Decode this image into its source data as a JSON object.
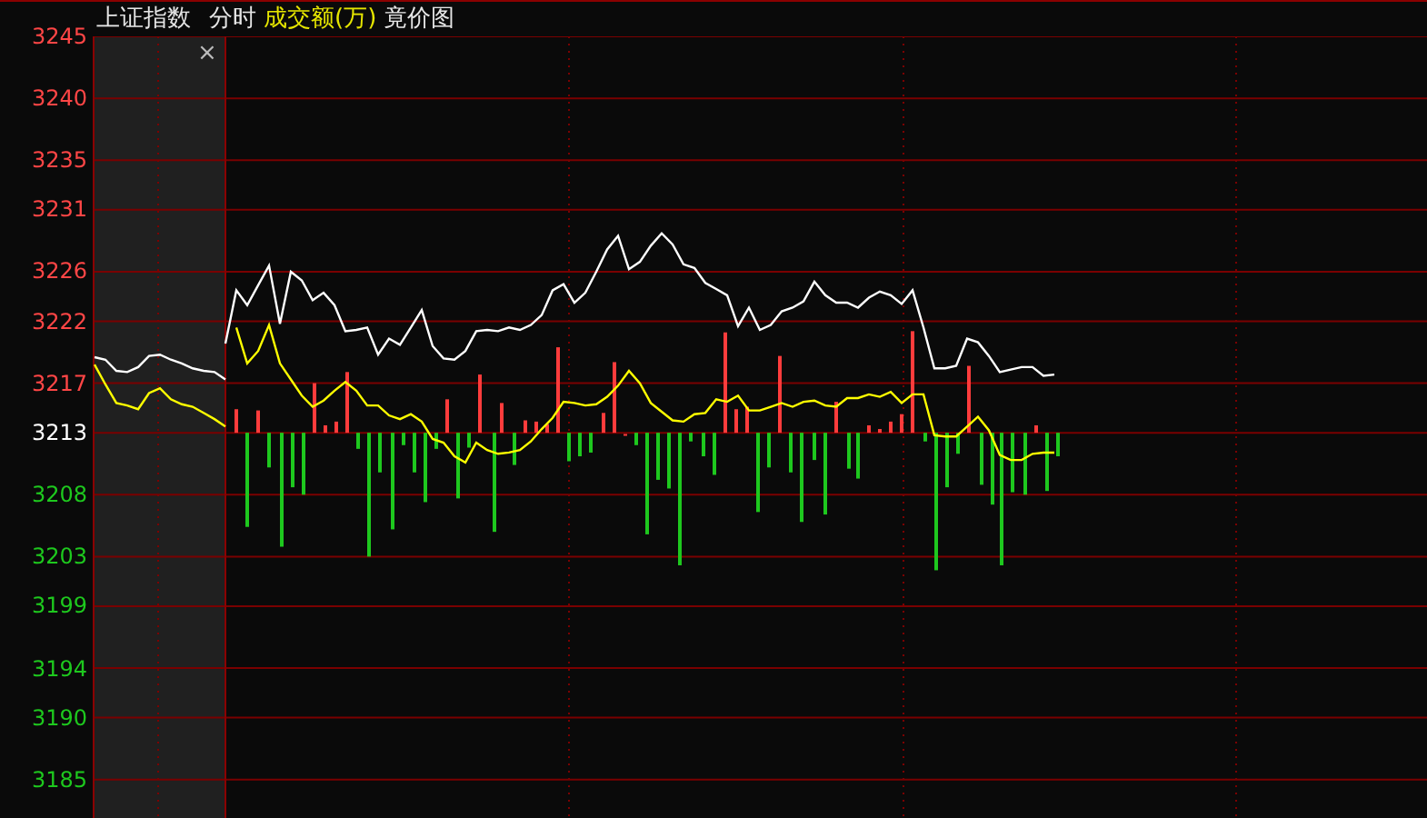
{
  "header": {
    "symbol": "上证指数",
    "mode": "分时",
    "indicator": "成交额(万)",
    "view": "竟价图"
  },
  "auction_panel": {
    "close": "×"
  },
  "chart": {
    "chart_data": {
      "type": "line",
      "ylim": [
        3181.9,
        3245
      ],
      "grid": true,
      "yticks": [
        {
          "value": 3245,
          "label": "3245"
        },
        {
          "value": 3240,
          "label": "3240"
        },
        {
          "value": 3235,
          "label": "3235"
        },
        {
          "value": 3231,
          "label": "3231"
        },
        {
          "value": 3226,
          "label": "3226"
        },
        {
          "value": 3222,
          "label": "3222"
        },
        {
          "value": 3217,
          "label": "3217"
        },
        {
          "value": 3213,
          "label": "3213"
        },
        {
          "value": 3208,
          "label": "3208"
        },
        {
          "value": 3203,
          "label": "3203"
        },
        {
          "value": 3199,
          "label": "3199"
        },
        {
          "value": 3194,
          "label": "3194"
        },
        {
          "value": 3190,
          "label": "3190"
        },
        {
          "value": 3185,
          "label": "3185"
        }
      ],
      "categories": [
        null,
        null,
        null,
        null,
        null,
        null,
        null,
        null,
        null,
        null,
        null,
        null,
        null,
        null,
        null,
        null,
        null,
        null,
        null,
        null,
        null,
        null,
        null,
        null,
        null,
        null,
        null,
        null,
        null,
        null,
        null,
        null,
        null,
        null,
        null,
        null,
        null,
        null,
        null,
        null,
        null,
        null,
        null,
        null,
        null,
        null,
        null,
        null,
        null,
        null,
        null,
        null,
        null,
        null,
        null,
        null,
        null,
        null,
        null,
        null,
        null,
        null,
        null,
        null,
        null,
        null,
        null,
        null,
        null,
        null,
        null,
        null,
        null,
        null,
        null,
        null,
        null,
        null,
        null,
        null,
        null,
        null,
        null,
        null,
        null,
        null,
        null,
        null,
        null
      ],
      "series": [
        {
          "color": "#ffffff",
          "values": [
            3219.1,
            3218.9,
            3218.0,
            3217.9,
            3218.3,
            3219.2,
            3219.3,
            3218.9,
            3218.6,
            3218.2,
            3218.0,
            3217.9,
            3217.3,
            null,
            null,
            null,
            null,
            null,
            null,
            null,
            null,
            null,
            null,
            null,
            null,
            null,
            null,
            null,
            null,
            null,
            null,
            null,
            null,
            null,
            null,
            null,
            null,
            null,
            null,
            null,
            null,
            null,
            null,
            null,
            null,
            null,
            null,
            null,
            null,
            null,
            null,
            null,
            null,
            null,
            null,
            null,
            null,
            null,
            null,
            null,
            null,
            null,
            null,
            null,
            null,
            null,
            null,
            null,
            null,
            null,
            null,
            null,
            null,
            null,
            null,
            null,
            null,
            null,
            null,
            null,
            null,
            null,
            null,
            null,
            null,
            null,
            null,
            null,
            null
          ]
        },
        {
          "color": "#ffff00",
          "values": [
            3218.5,
            3216.9,
            3215.4,
            3215.2,
            3214.9,
            3216.2,
            3216.6,
            3215.7,
            3215.3,
            3215.1,
            3214.6,
            3214.1,
            3213.5,
            null,
            null,
            null,
            null,
            null,
            null,
            null,
            null,
            null,
            null,
            null,
            null,
            null,
            null,
            null,
            null,
            null,
            null,
            null,
            null,
            null,
            null,
            null,
            null,
            null,
            null,
            null,
            null,
            null,
            null,
            null,
            null,
            null,
            null,
            null,
            null,
            null,
            null,
            null,
            null,
            null,
            null,
            null,
            null,
            null,
            null,
            null,
            null,
            null,
            null,
            null,
            null,
            null,
            null,
            null,
            null,
            null,
            null,
            null,
            null,
            null,
            null,
            null,
            null,
            null,
            null,
            null,
            null,
            null,
            null,
            null,
            null,
            null,
            null,
            null,
            null
          ]
        },
        {
          "color": "#ffffff",
          "values": [
            null,
            null,
            null,
            null,
            null,
            null,
            null,
            null,
            null,
            null,
            null,
            null,
            3220.2,
            3224.5,
            3223.3,
            3224.9,
            3226.5,
            3221.8,
            3226.0,
            3225.3,
            3223.7,
            3224.3,
            3223.3,
            3221.2,
            3221.3,
            3221.5,
            3219.3,
            3220.6,
            3220.1,
            3221.5,
            3222.9,
            3220.0,
            3219.0,
            3218.9,
            3219.6,
            3221.2,
            3221.3,
            3221.2,
            3221.5,
            3221.3,
            3221.7,
            3222.5,
            3224.5,
            3225.0,
            3223.5,
            3224.3,
            3226.0,
            3227.8,
            3228.9,
            3226.2,
            3226.8,
            3228.1,
            3229.1,
            3228.2,
            3226.6,
            3226.3,
            3225.1,
            3224.6,
            3224.1,
            3221.6,
            3223.1,
            3221.3,
            3221.7,
            3222.8,
            3223.1,
            3223.6,
            3225.2,
            3224.1,
            3223.5,
            3223.5,
            3223.1,
            3223.9,
            3224.4,
            3224.1,
            3223.4,
            3224.5,
            3221.5,
            3218.2,
            3218.2,
            3218.4,
            3220.6,
            3220.3,
            3219.2,
            3217.9,
            3218.1,
            3218.3,
            3218.3,
            3217.6,
            3217.7
          ]
        },
        {
          "color": "#ffff00",
          "values": [
            null,
            null,
            null,
            null,
            null,
            null,
            null,
            null,
            null,
            null,
            null,
            null,
            null,
            3221.5,
            3218.6,
            3219.6,
            3221.7,
            3218.6,
            3217.3,
            3216.0,
            3215.1,
            3215.6,
            3216.4,
            3217.1,
            3216.4,
            3215.2,
            3215.2,
            3214.4,
            3214.1,
            3214.5,
            3213.9,
            3212.5,
            3212.2,
            3211.1,
            3210.6,
            3212.2,
            3211.6,
            3211.3,
            3211.4,
            3211.6,
            3212.3,
            3213.3,
            3214.2,
            3215.5,
            3215.4,
            3215.2,
            3215.3,
            3215.9,
            3216.8,
            3218.0,
            3217.0,
            3215.4,
            3214.7,
            3214.0,
            3213.9,
            3214.5,
            3214.6,
            3215.7,
            3215.5,
            3216.0,
            3214.8,
            3214.8,
            3215.1,
            3215.4,
            3215.1,
            3215.5,
            3215.6,
            3215.2,
            3215.1,
            3215.8,
            3215.8,
            3216.1,
            3215.9,
            3216.3,
            3215.4,
            3216.1,
            3216.1,
            3212.8,
            3212.7,
            3212.7,
            3213.5,
            3214.3,
            3213.2,
            3211.2,
            3210.8,
            3210.8,
            3211.3,
            3211.4,
            3211.4
          ]
        }
      ]
    }
  }
}
